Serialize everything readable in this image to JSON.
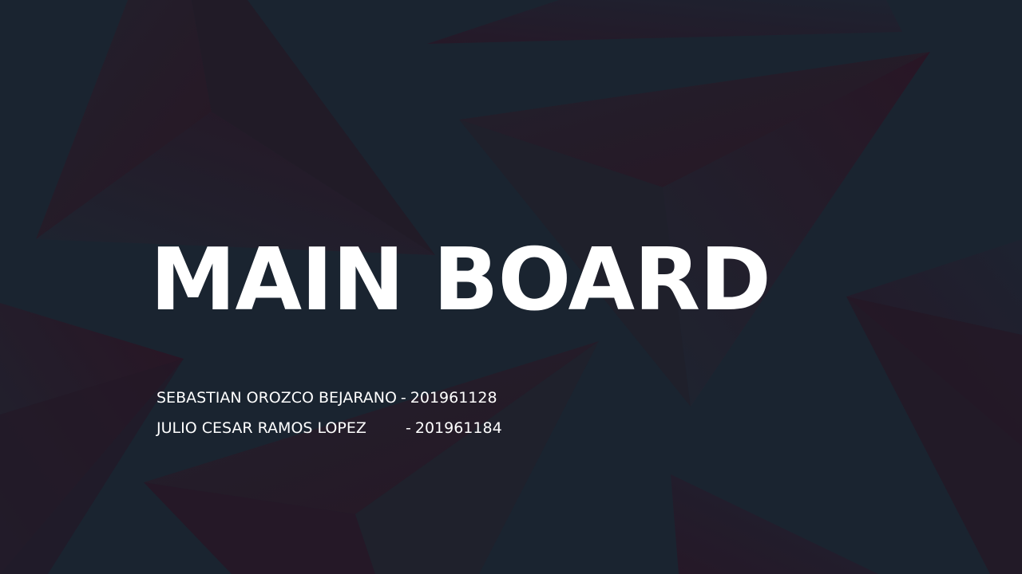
{
  "slide": {
    "title": "MAIN BOARD",
    "authors": [
      {
        "name": "SEBASTIAN OROZCO BEJARANO",
        "separator": "-",
        "id": "201961128"
      },
      {
        "name": "JULIO CESAR RAMOS LOPEZ",
        "separator": "-",
        "id": "201961184"
      }
    ]
  },
  "colors": {
    "background": "#1a2430",
    "shard_dark": "#1f1a26",
    "shard_maroon": "#2a1424",
    "text": "#ffffff"
  }
}
